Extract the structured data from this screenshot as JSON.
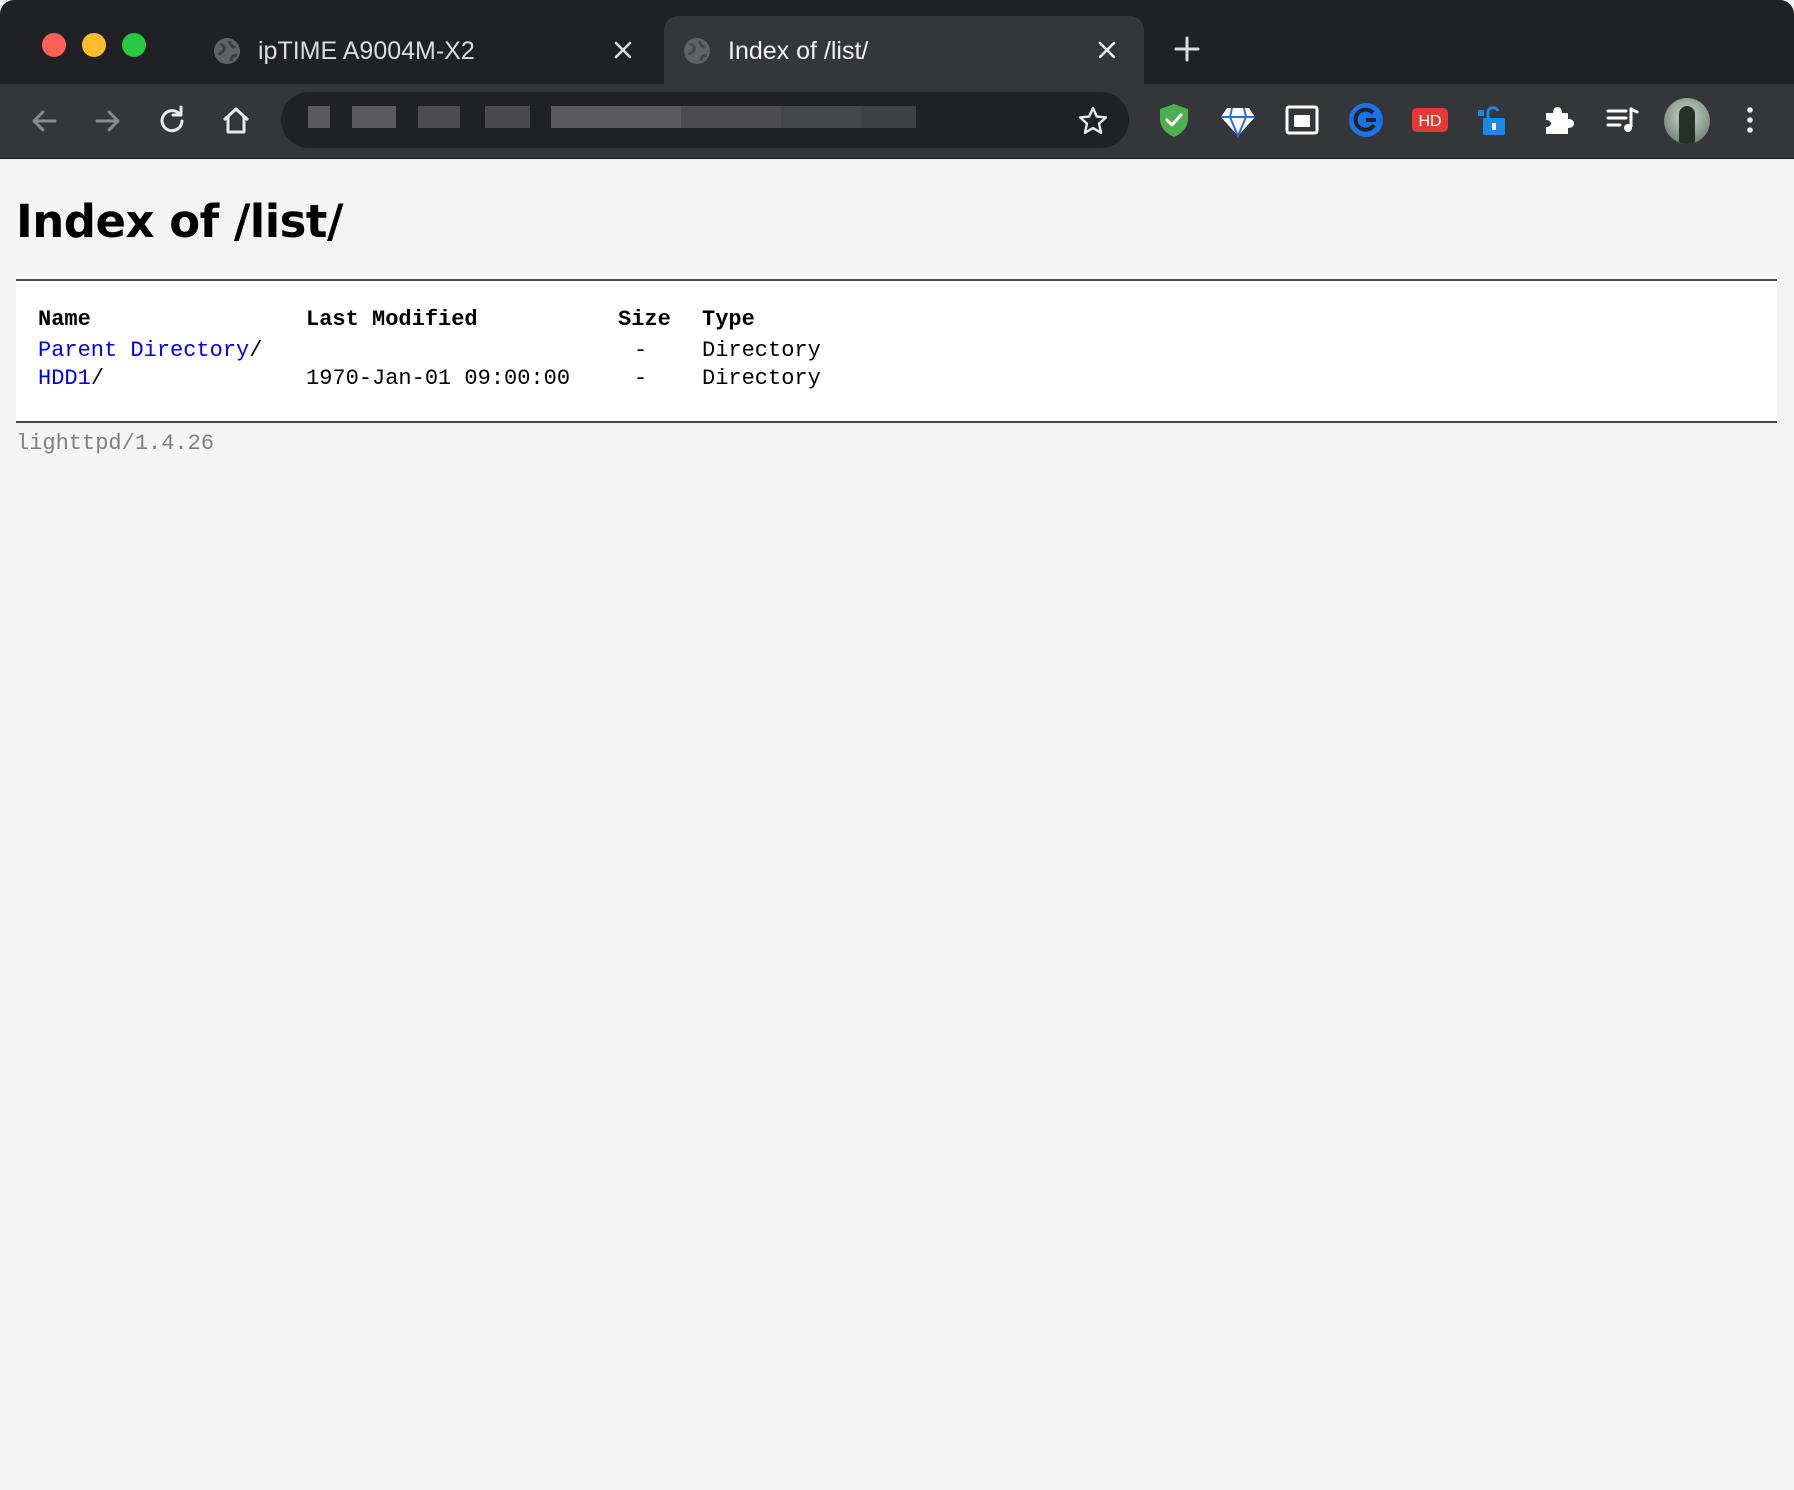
{
  "browser": {
    "tabs": [
      {
        "title": "ipTIME A9004M-X2",
        "active": false
      },
      {
        "title": "Index of /list/",
        "active": true
      }
    ],
    "icons": {
      "back": "arrow-left-icon",
      "forward": "arrow-right-icon",
      "reload": "reload-icon",
      "home": "home-icon",
      "bookmark": "star-icon",
      "menu": "kebab-menu-icon"
    },
    "extensions": [
      {
        "name": "shield-check-icon",
        "color": "#4caf50"
      },
      {
        "name": "diamond-icon",
        "color": "#ffffff"
      },
      {
        "name": "picture-in-picture-icon",
        "color": "#ffffff"
      },
      {
        "name": "circle-c-icon",
        "color": "#1a73e8"
      },
      {
        "name": "hd-badge-icon",
        "color": "#e53935",
        "text": "HD"
      },
      {
        "name": "unlock-icon",
        "color": "#1e88e5"
      },
      {
        "name": "puzzle-icon",
        "color": "#ffffff"
      },
      {
        "name": "media-queue-icon",
        "color": "#ffffff"
      }
    ]
  },
  "page": {
    "title": "Index of /list/",
    "table": {
      "headers": [
        "Name",
        "Last Modified",
        "Size",
        "Type"
      ],
      "rows": [
        {
          "name": "Parent Directory",
          "suffix": "/",
          "modified": "",
          "size": "-",
          "type": "Directory"
        },
        {
          "name": "HDD1",
          "suffix": "/",
          "modified": "1970-Jan-01 09:00:00",
          "size": "-",
          "type": "Directory"
        }
      ]
    },
    "footer": "lighttpd/1.4.26",
    "link_color": "#0000ee"
  }
}
